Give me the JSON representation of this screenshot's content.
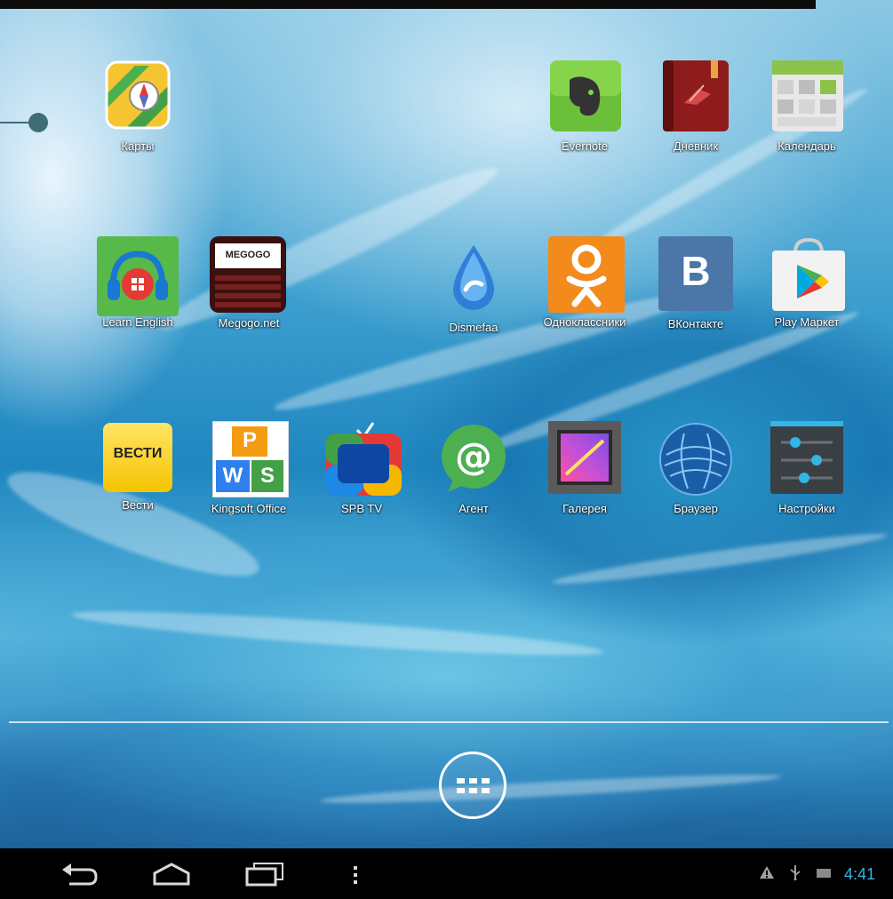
{
  "home": {
    "apps": [
      {
        "label": "Карты",
        "icon": "maps-icon"
      },
      {
        "label": "Evernote",
        "icon": "evernote-icon"
      },
      {
        "label": "Дневник",
        "icon": "diary-icon"
      },
      {
        "label": "Календарь",
        "icon": "calendar-icon"
      },
      {
        "label": "Learn English",
        "icon": "learn-english-icon"
      },
      {
        "label": "Megogo.net",
        "icon": "megogo-icon"
      },
      {
        "label": "Dismefaa",
        "icon": "droplet-icon"
      },
      {
        "label": "Одноклассники",
        "icon": "odnoklassniki-icon"
      },
      {
        "label": "ВКонтакте",
        "icon": "vkontakte-icon"
      },
      {
        "label": "Play Маркет",
        "icon": "play-market-icon"
      },
      {
        "label": "Вести",
        "icon": "vesti-icon"
      },
      {
        "label": "Kingsoft Office",
        "icon": "kingsoft-office-icon"
      },
      {
        "label": "SPB TV",
        "icon": "spb-tv-icon"
      },
      {
        "label": "Агент",
        "icon": "agent-icon"
      },
      {
        "label": "Галерея",
        "icon": "gallery-icon"
      },
      {
        "label": "Браузер",
        "icon": "browser-icon"
      },
      {
        "label": "Настройки",
        "icon": "settings-icon"
      }
    ],
    "icon_text": {
      "megogo": "MEGOGO",
      "vesti": "ВЕСТИ",
      "vk": "B",
      "kingsoft_p": "P",
      "kingsoft_w": "W",
      "kingsoft_s": "S"
    },
    "app_drawer": {
      "icon": "app-drawer-icon"
    }
  },
  "navbar": {
    "buttons": [
      "back-icon",
      "home-icon",
      "recent-apps-icon",
      "menu-icon"
    ],
    "status": {
      "icons": [
        "warning-icon",
        "usb-icon",
        "battery-icon"
      ],
      "time": "4:41"
    }
  },
  "colors": {
    "clock": "#33b5e5",
    "navbar": "#000000"
  }
}
